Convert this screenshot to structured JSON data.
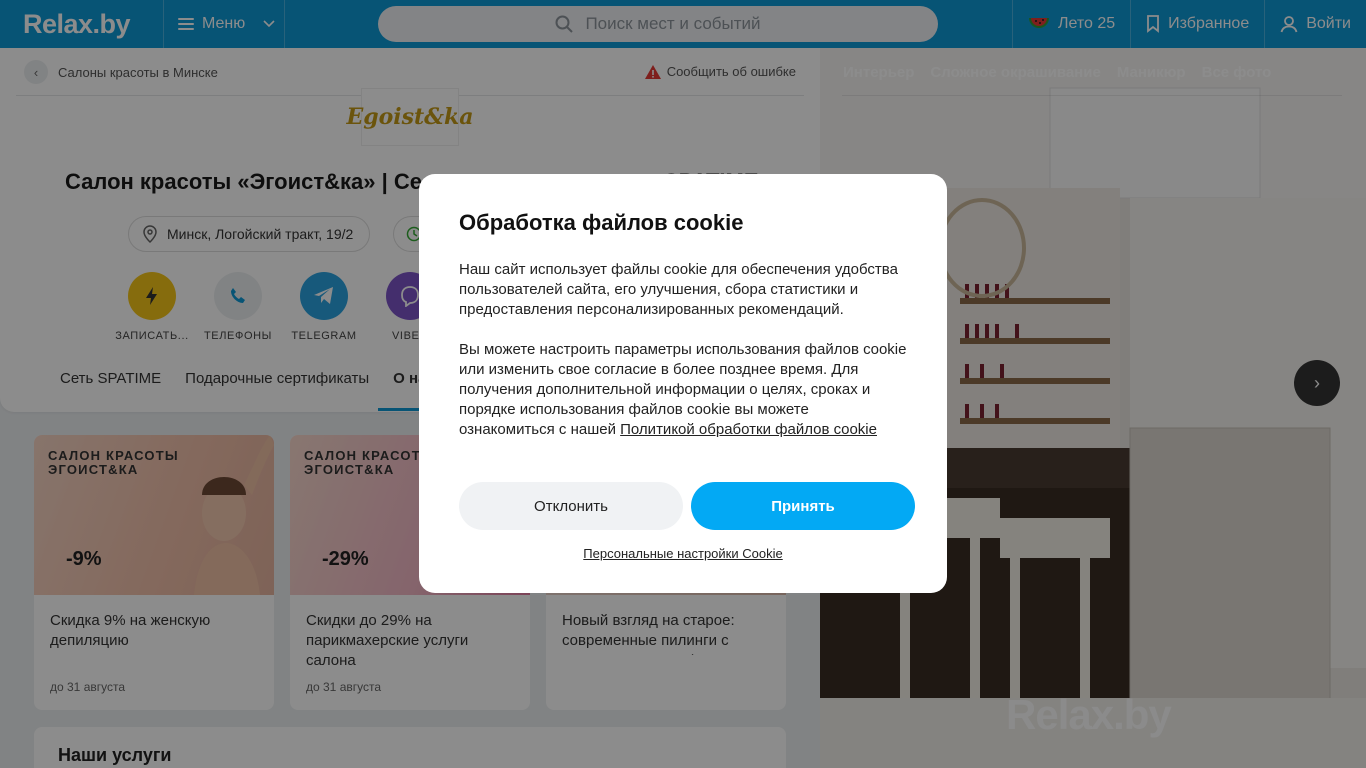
{
  "header": {
    "logo": "Relax.by",
    "menu_label": "Меню",
    "search_placeholder": "Поиск мест и событий",
    "summer_label": "Лето 25",
    "favorites_label": "Избранное",
    "login_label": "Войти"
  },
  "page": {
    "breadcrumb": "Салоны красоты в Минске",
    "report_label": "Сообщить об ошибке",
    "salon_logo_text": "Egoist&ka",
    "title": "Салон красоты «Эгоист&ка» | Се",
    "title_tail": "SPATIME",
    "address": "Минск, Логойский тракт, 19/2",
    "actions": [
      {
        "label": "ЗАПИСАТЬ...",
        "color": "#f5c518",
        "icon": "lightning-icon"
      },
      {
        "label": "ТЕЛЕФОНЫ",
        "color": "#eceff1",
        "icon": "phone-icon"
      },
      {
        "label": "TELEGRAM",
        "color": "#2aa3e0",
        "icon": "telegram-icon"
      },
      {
        "label": "VIBE",
        "color": "#7d55c7",
        "icon": "viber-icon"
      }
    ],
    "tabs": [
      "Сеть SPATIME",
      "Подарочные сертификаты",
      "О на"
    ]
  },
  "promos": [
    {
      "brand": "САЛОН КРАСОТЫ\nЭГОИСТ&КА",
      "discount": "-9%",
      "text": "Скидка 9% на женскую депиляцию",
      "date": "до 31 августа"
    },
    {
      "brand": "САЛОН КРАСОТ\nЭГОИСТ&КА",
      "discount": "-29%",
      "text": "Скидки до 29% на парикмахерские услуги салона",
      "date": "до 31 августа"
    },
    {
      "brand": "",
      "discount": "",
      "text": "Новый взгляд на старое: современные пилинги с применением парфюмерно...",
      "date": ""
    }
  ],
  "services_title": "Наши услуги",
  "photo": {
    "tabs": [
      "Интерьер",
      "Сложное окрашивание",
      "Маникюр",
      "Все фото"
    ],
    "watermark": "Relax.by"
  },
  "cookie_modal": {
    "title": "Обработка файлов cookie",
    "paragraph1": "Наш сайт использует файлы cookie для обеспечения удобства пользователей сайта, его улучшения, сбора статистики и предоставления персонализированных рекомендаций.",
    "paragraph2": "Вы можете настроить параметры использования файлов cookie или изменить свое согласие в более позднее время. Для получения дополнительной информации о целях, сроках и порядке использования файлов cookie вы можете ознакомиться с нашей",
    "policy_link": "Политикой обработки файлов cookie",
    "decline_label": "Отклонить",
    "accept_label": "Принять",
    "settings_link": "Персональные настройки Cookie"
  }
}
